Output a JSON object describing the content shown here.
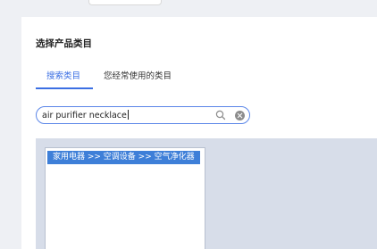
{
  "header": {
    "title": "选择产品类目"
  },
  "tabs": [
    {
      "label": "搜索类目",
      "active": true
    },
    {
      "label": "您经常使用的类目",
      "active": false
    }
  ],
  "search": {
    "value": "air purifier necklace",
    "search_icon": "search-icon",
    "clear_icon": "clear-icon"
  },
  "results": {
    "items": [
      {
        "label": "家用电器 >> 空调设备 >> 空气净化器",
        "selected": true
      }
    ]
  },
  "colors": {
    "accent": "#3b6fe3",
    "selected_item_bg": "#3e7fd8",
    "results_panel_bg": "#d7dde9",
    "page_bg": "#eef0f4"
  }
}
